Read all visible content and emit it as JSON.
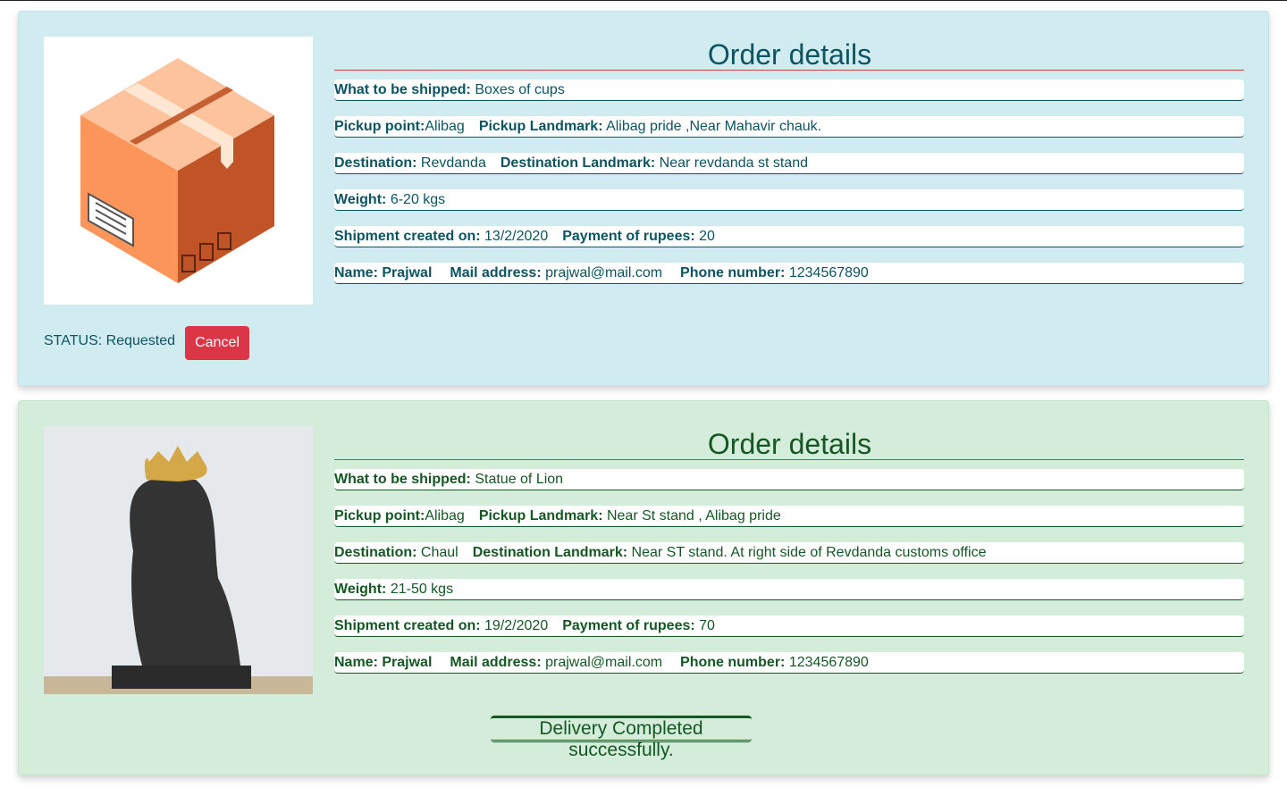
{
  "orders": [
    {
      "title": "Order details",
      "item_label": "What to be shipped:",
      "item": "Boxes of cups",
      "pickup_label": "Pickup point:",
      "pickup": "Alibag",
      "pickup_landmark_label": "Pickup Landmark:",
      "pickup_landmark": "Alibag pride ,Near Mahavir chauk.",
      "dest_label": "Destination:",
      "dest": "Revdanda",
      "dest_landmark_label": "Destination Landmark:",
      "dest_landmark": "Near revdanda st stand",
      "weight_label": "Weight:",
      "weight": "6-20 kgs",
      "created_label": "Shipment created on:",
      "created": "13/2/2020",
      "payment_label": "Payment of rupees:",
      "payment": "20",
      "name_label": "Name: Prajwal",
      "mail_label": "Mail address:",
      "mail": "prajwal@mail.com",
      "phone_label": "Phone number:",
      "phone": "1234567890",
      "status": "STATUS: Requested",
      "cancel_label": "Cancel",
      "image": "cardboard-box-illustration"
    },
    {
      "title": "Order details",
      "item_label": "What to be shipped:",
      "item": "Statue of Lion",
      "pickup_label": "Pickup point:",
      "pickup": "Alibag",
      "pickup_landmark_label": "Pickup Landmark:",
      "pickup_landmark": "Near St stand , Alibag pride",
      "dest_label": "Destination:",
      "dest": "Chaul",
      "dest_landmark_label": "Destination Landmark:",
      "dest_landmark": "Near ST stand. At right side of Revdanda customs office",
      "weight_label": "Weight:",
      "weight": "21-50 kgs",
      "created_label": "Shipment created on:",
      "created": "19/2/2020",
      "payment_label": "Payment of rupees:",
      "payment": "70",
      "name_label": "Name: Prajwal",
      "mail_label": "Mail address:",
      "mail": "prajwal@mail.com",
      "phone_label": "Phone number:",
      "phone": "1234567890",
      "status": "Delivery Completed successfully.",
      "image": "lion-statue-photo"
    }
  ],
  "colors": {
    "info_bg": "#d1ecf1",
    "info_text": "#0c5460",
    "success_bg": "#d4edda",
    "success_text": "#155724",
    "danger": "#dc3545"
  }
}
